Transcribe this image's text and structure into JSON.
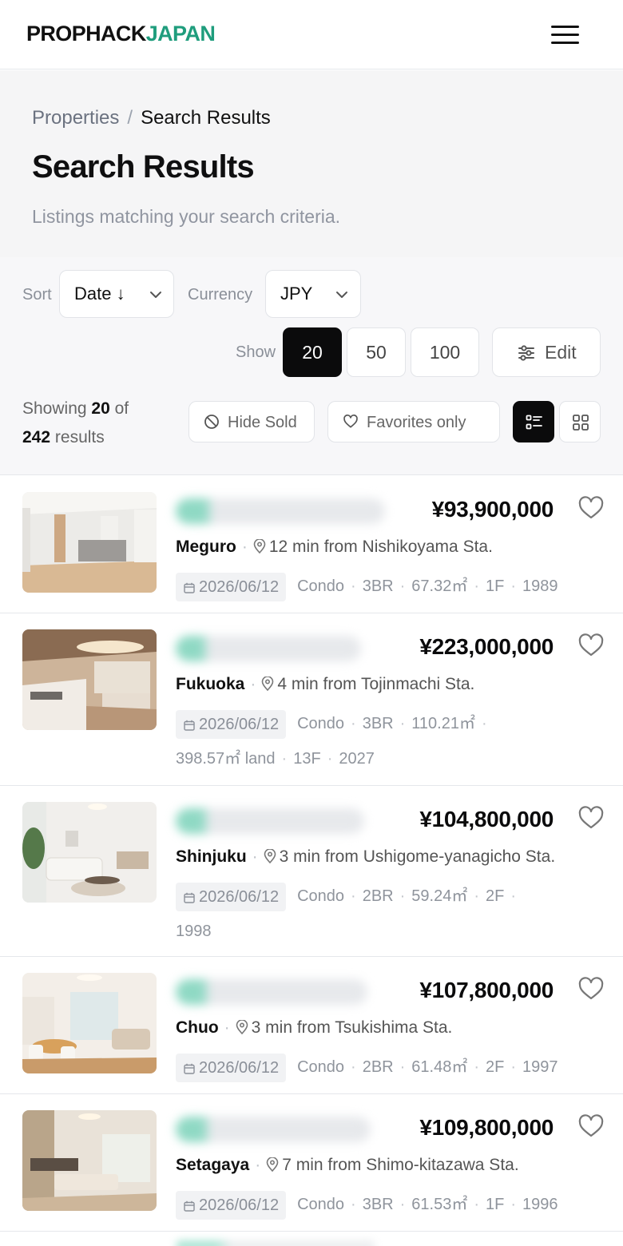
{
  "brand": {
    "part1": "PROPHACK",
    "part2": "JAPAN",
    "accent": "#1f9d7d"
  },
  "header": {
    "menu_icon": "hamburger-menu-icon"
  },
  "breadcrumb": {
    "parent": "Properties",
    "separator": "/",
    "current": "Search Results"
  },
  "page": {
    "title": "Search Results",
    "subtitle": "Listings matching your search criteria."
  },
  "controls": {
    "sort_label": "Sort",
    "sort_value": "Date ↓",
    "currency_label": "Currency",
    "currency_value": "JPY",
    "show_label": "Show",
    "page_sizes": [
      "20",
      "50",
      "100"
    ],
    "page_size_selected": "20",
    "edit_label": "Edit",
    "showing_prefix": "Showing",
    "showing_count": "20",
    "showing_of": "of",
    "total": "242",
    "results_word": "results",
    "hide_sold_label": "Hide Sold",
    "favorites_label": "Favorites only",
    "view_selected": "list"
  },
  "listings": [
    {
      "price": "¥93,900,000",
      "ward": "Meguro",
      "station": "12 min from Nishikoyama Sta.",
      "date": "2026/06/12",
      "type": "Condo",
      "bedrooms": "3BR",
      "area": "67.32㎡",
      "floor": "1F",
      "year": "1989"
    },
    {
      "price": "¥223,000,000",
      "ward": "Fukuoka",
      "station": "4 min from Tojinmachi Sta.",
      "date": "2026/06/12",
      "type": "Condo",
      "bedrooms": "3BR",
      "area": "110.21㎡",
      "land": "398.57㎡ land",
      "floor": "13F",
      "year": "2027"
    },
    {
      "price": "¥104,800,000",
      "ward": "Shinjuku",
      "station": "3 min from Ushigome-yanagicho Sta.",
      "date": "2026/06/12",
      "type": "Condo",
      "bedrooms": "2BR",
      "area": "59.24㎡",
      "floor": "2F",
      "year": "1998"
    },
    {
      "price": "¥107,800,000",
      "ward": "Chuo",
      "station": "3 min from Tsukishima Sta.",
      "date": "2026/06/12",
      "type": "Condo",
      "bedrooms": "2BR",
      "area": "61.48㎡",
      "floor": "2F",
      "year": "1997"
    },
    {
      "price": "¥109,800,000",
      "ward": "Setagaya",
      "station": "7 min from Shimo-kitazawa Sta.",
      "date": "2026/06/12",
      "type": "Condo",
      "bedrooms": "3BR",
      "area": "61.53㎡",
      "floor": "1F",
      "year": "1996"
    }
  ]
}
